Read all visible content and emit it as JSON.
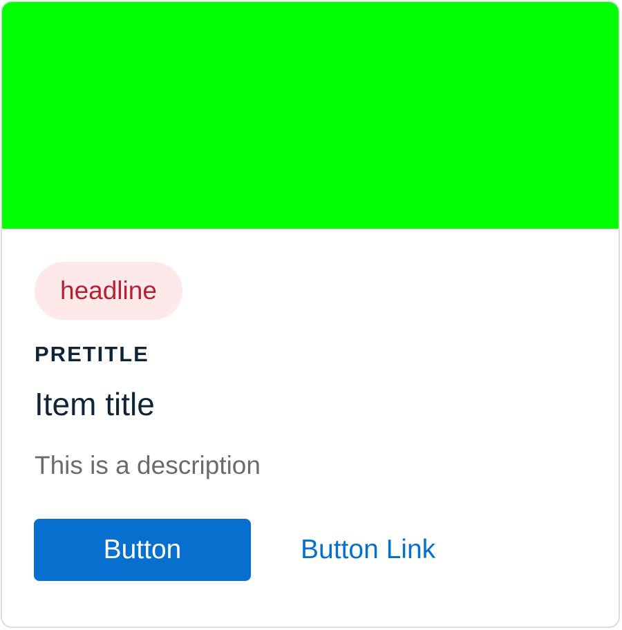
{
  "card": {
    "media_color": "#00ff00",
    "headline": "headline",
    "pretitle": "PRETITLE",
    "title": "Item title",
    "description": "This is a description",
    "primary_button_label": "Button",
    "link_button_label": "Button Link"
  },
  "colors": {
    "badge_background": "#fde9ea",
    "badge_text": "#b52133",
    "heading_text": "#0f2537",
    "description_text": "#6b6b6b",
    "primary": "#0770cf",
    "link": "#0770cf",
    "card_border": "#dcdcdc"
  }
}
